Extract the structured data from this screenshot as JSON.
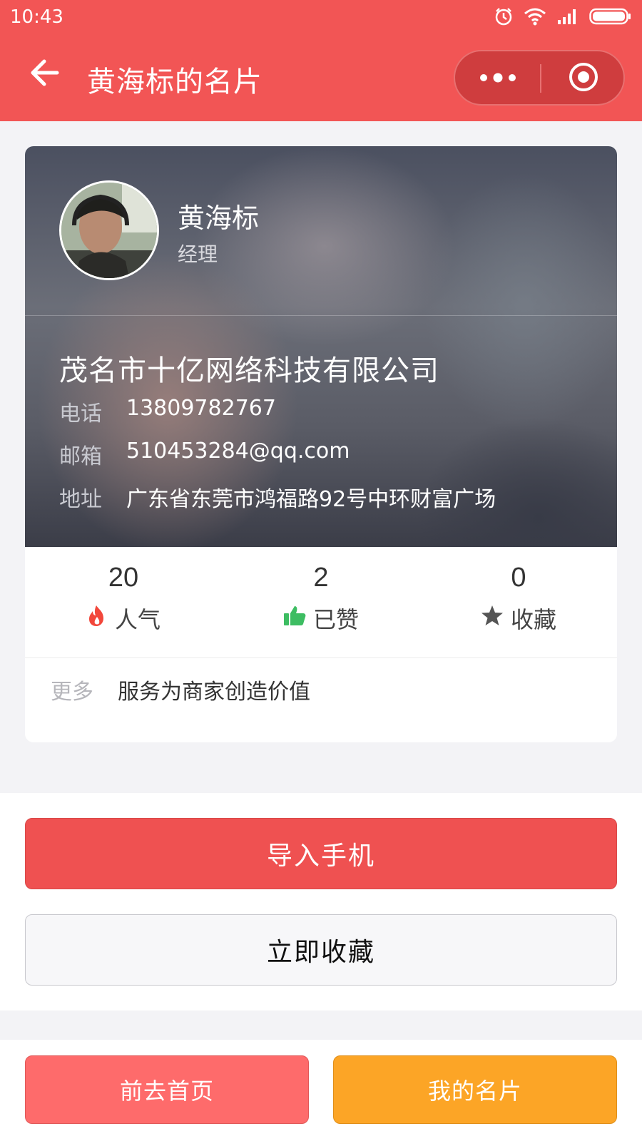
{
  "status_bar": {
    "time": "10:43",
    "icons": [
      "alarm-icon",
      "wifi-icon",
      "signal-icon",
      "battery-icon"
    ]
  },
  "nav": {
    "title": "黄海标的名片",
    "back_icon": "arrow-left-icon",
    "more_icon": "more-dots-icon",
    "close_icon": "target-circle-icon"
  },
  "card": {
    "name": "黄海标",
    "role": "经理",
    "company": "茂名市十亿网络科技有限公司",
    "phone_label": "电话",
    "phone": "13809782767",
    "email_label": "邮箱",
    "email": "510453284@qq.com",
    "address_label": "地址",
    "address": "广东省东莞市鸿福路92号中环财富广场"
  },
  "stats": [
    {
      "value": "20",
      "label": "人气",
      "icon": "fire-icon",
      "color": "#f2473b"
    },
    {
      "value": "2",
      "label": "已赞",
      "icon": "thumbs-up-icon",
      "color": "#3dbd62"
    },
    {
      "value": "0",
      "label": "收藏",
      "icon": "star-icon",
      "color": "#555555"
    }
  ],
  "more": {
    "label": "更多",
    "text": "服务为商家创造价值"
  },
  "actions": {
    "import_label": "导入手机",
    "collect_label": "立即收藏"
  },
  "bottom": {
    "home_label": "前去首页",
    "mycard_label": "我的名片"
  },
  "colors": {
    "primary": "#f25555",
    "home_button": "#fe6b6b",
    "mycard_button": "#fca526"
  }
}
